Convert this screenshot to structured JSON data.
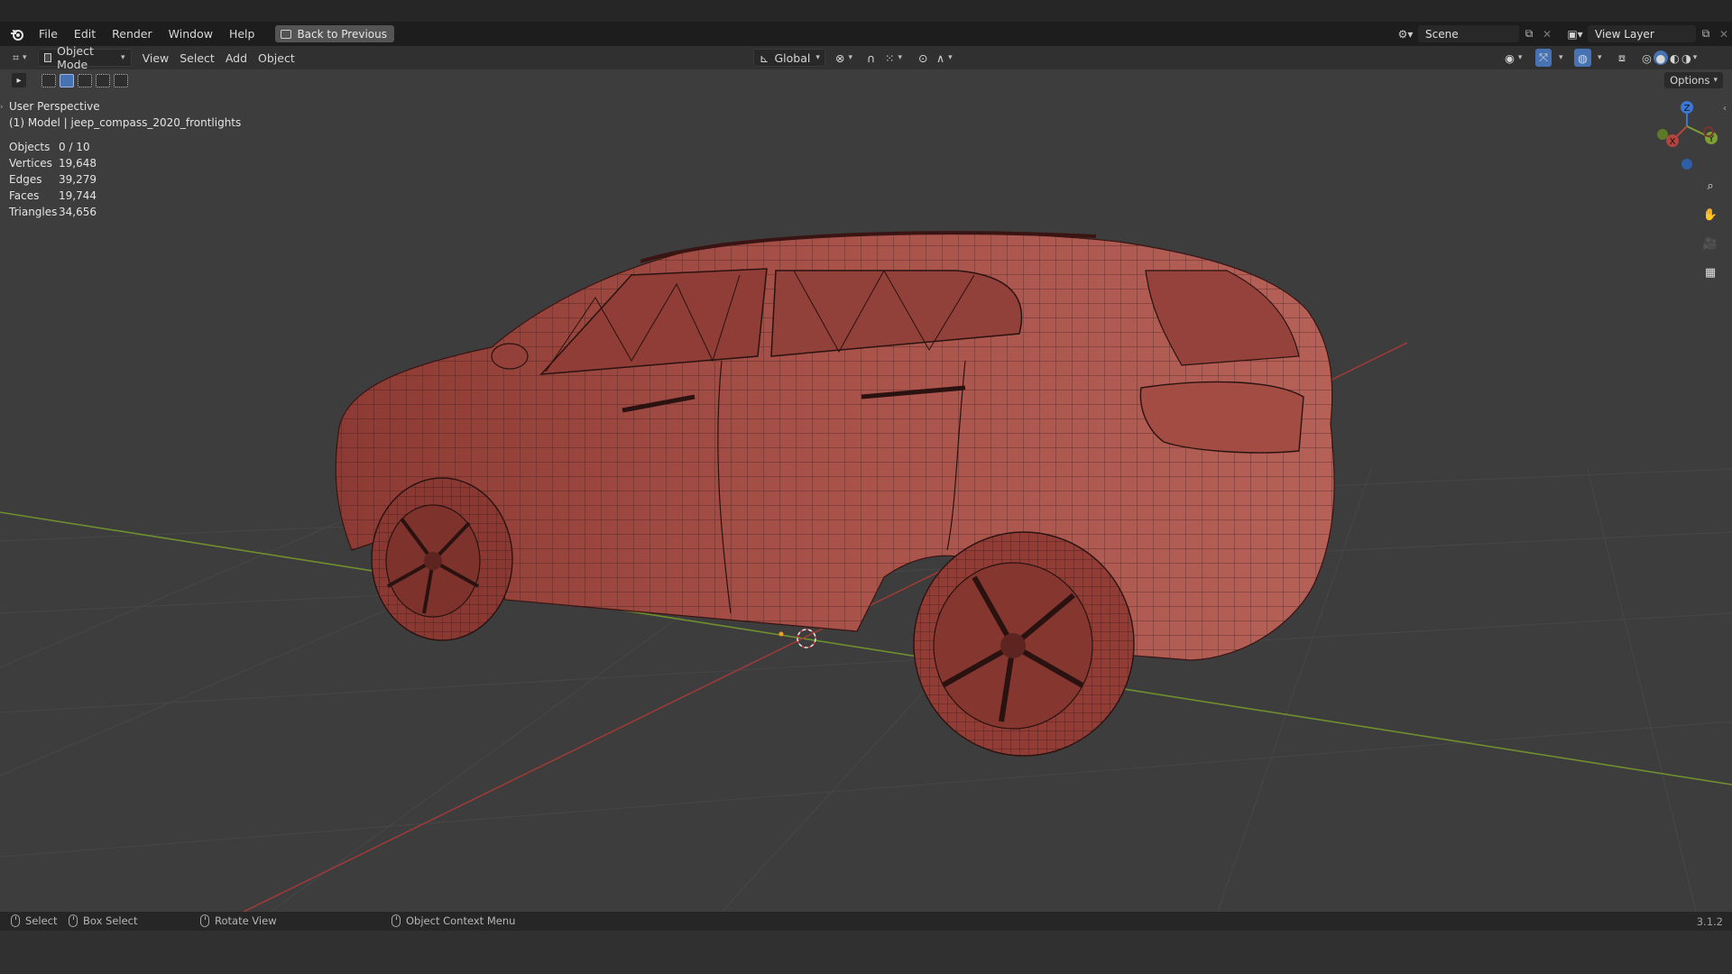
{
  "topbar": {
    "menu": [
      "File",
      "Edit",
      "Render",
      "Window",
      "Help"
    ],
    "back_button": "Back to Previous",
    "scene_label": "Scene",
    "view_layer_label": "View Layer"
  },
  "header": {
    "mode": "Object Mode",
    "menus": [
      "View",
      "Select",
      "Add",
      "Object"
    ],
    "orientation": "Global",
    "options_label": "Options"
  },
  "viewport": {
    "perspective_label": "User Perspective",
    "object_label": "(1) Model | jeep_compass_2020_frontlights",
    "stats": [
      {
        "label": "Objects",
        "value": "0 / 10"
      },
      {
        "label": "Vertices",
        "value": "19,648"
      },
      {
        "label": "Edges",
        "value": "39,279"
      },
      {
        "label": "Faces",
        "value": "19,744"
      },
      {
        "label": "Triangles",
        "value": "34,656"
      }
    ],
    "gizmo_axes": {
      "x": "X",
      "y": "Y",
      "z": "Z"
    },
    "model_color": "#a0463f"
  },
  "statusbar": {
    "select": "Select",
    "box_select": "Box Select",
    "rotate_view": "Rotate View",
    "context_menu": "Object Context Menu",
    "version": "3.1.2"
  },
  "colors": {
    "x_axis": "#b3443f",
    "y_axis": "#7ca033",
    "z_axis": "#3a78d6",
    "background": "#3d3d3d"
  }
}
